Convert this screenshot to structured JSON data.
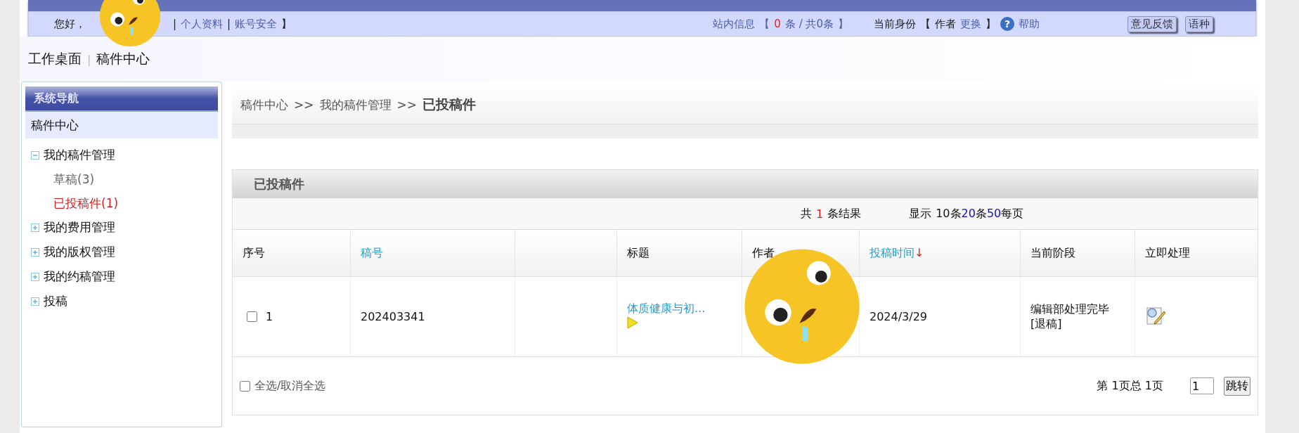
{
  "header": {
    "greeting": "您好，",
    "open_bracket": "|",
    "links": [
      {
        "label": "个人资料"
      },
      {
        "label": "账号安全"
      }
    ],
    "link_separator": "|",
    "close_bracket": "】",
    "messages": {
      "label": "站内信息",
      "open_bracket": "【",
      "unread": "0",
      "rest": "条 / 共0条",
      "close_bracket": "】"
    },
    "identity": {
      "label": "当前身份",
      "open_bracket": "【",
      "role": "作者",
      "switch": "更换",
      "close_bracket": "】"
    },
    "help_icon": "?",
    "help": "帮助",
    "buttons": [
      "意见反馈",
      "语种"
    ]
  },
  "breadcrumb_top": {
    "items": [
      "工作桌面",
      "稿件中心"
    ],
    "separator": "|"
  },
  "sidebar": {
    "title": "系统导航",
    "section": "稿件中心",
    "items": [
      {
        "label": "我的稿件管理",
        "expanded": true,
        "children": [
          {
            "label": "草稿(3)",
            "selected": false
          },
          {
            "label": "已投稿件(1)",
            "selected": true
          }
        ]
      },
      {
        "label": "我的费用管理",
        "expanded": false
      },
      {
        "label": "我的版权管理",
        "expanded": false
      },
      {
        "label": "我的约稿管理",
        "expanded": false
      },
      {
        "label": "投稿",
        "expanded": false
      }
    ]
  },
  "breadcrumb": {
    "items": [
      "稿件中心",
      "我的稿件管理"
    ],
    "separator": ">>",
    "current": "已投稿件"
  },
  "panel": {
    "title": "已投稿件",
    "summary": {
      "prefix": "共",
      "count": "1",
      "suffix": "条结果",
      "display_label": "显示",
      "page_sizes": [
        {
          "label": "10",
          "suffix": "条",
          "selected": true
        },
        {
          "label": "20",
          "suffix": "条",
          "selected": false
        },
        {
          "label": "50",
          "suffix": "每页",
          "selected": false
        }
      ]
    },
    "table": {
      "columns": [
        {
          "label": "序号",
          "sortable": false
        },
        {
          "label": "稿号",
          "sortable": true
        },
        {},
        {
          "label": "标题",
          "sortable": false
        },
        {
          "label": "作者",
          "sortable": false
        },
        {
          "label": "投稿时间",
          "sortable": true,
          "sort_indicator": "↓"
        },
        {
          "label": "当前阶段",
          "sortable": false
        },
        {
          "label": "立即处理",
          "sortable": false
        }
      ],
      "rows": [
        {
          "checked": false,
          "index": "1",
          "number": "202403341",
          "title": "体质健康与初...",
          "date": "2024/3/29",
          "stage": [
            "编辑部处理完毕",
            "[退稿]"
          ]
        }
      ]
    },
    "select_all": {
      "label": "全选/取消全选",
      "checked": false
    },
    "pagination": {
      "info": "第 1页总 1页",
      "page_input": "1",
      "go": "跳转"
    }
  }
}
